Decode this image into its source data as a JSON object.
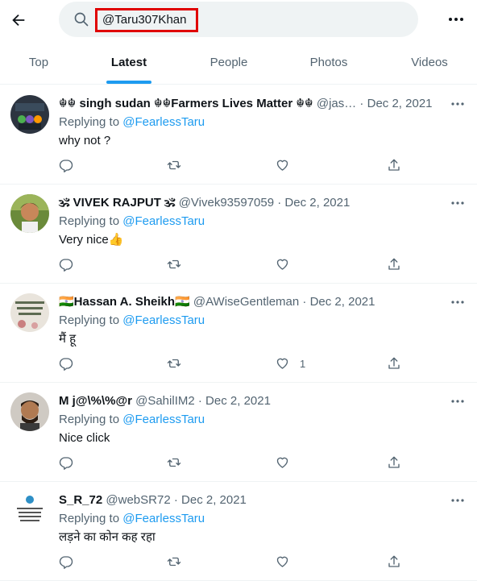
{
  "search": {
    "query": "@Taru307Khan"
  },
  "tabs": [
    {
      "label": "Top",
      "active": false
    },
    {
      "label": "Latest",
      "active": true
    },
    {
      "label": "People",
      "active": false
    },
    {
      "label": "Photos",
      "active": false
    },
    {
      "label": "Videos",
      "active": false
    }
  ],
  "tweets": [
    {
      "name": "☬☬ singh sudan ☬☬Farmers Lives Matter ☬☬",
      "handle": "@jas…",
      "date": "Dec 2, 2021",
      "replying_prefix": "Replying to",
      "replying_to": "@FearlessTaru",
      "text": "why not ?",
      "likes": ""
    },
    {
      "name": "🕉 VIVEK RAJPUT 🕉",
      "handle": "@Vivek93597059",
      "date": "Dec 2, 2021",
      "replying_prefix": "Replying to",
      "replying_to": "@FearlessTaru",
      "text": "Very nice👍",
      "likes": ""
    },
    {
      "name": "🇮🇳Hassan A. Sheikh🇮🇳",
      "handle": "@AWiseGentleman",
      "date": "Dec 2, 2021",
      "replying_prefix": "Replying to",
      "replying_to": "@FearlessTaru",
      "text": "मैं हू",
      "likes": "1"
    },
    {
      "name": "M j@\\%\\%@r",
      "handle": "@SahilIM2",
      "date": "Dec 2, 2021",
      "replying_prefix": "Replying to",
      "replying_to": "@FearlessTaru",
      "text": "Nice click",
      "likes": ""
    },
    {
      "name": "S_R_72",
      "handle": "@webSR72",
      "date": "Dec 2, 2021",
      "replying_prefix": "Replying to",
      "replying_to": "@FearlessTaru",
      "text": "लड़ने का कोन कह रहा",
      "likes": ""
    }
  ],
  "colors": {
    "accent": "#1d9bf0",
    "text": "#0f1419",
    "secondary": "#536471",
    "highlight_box": "#e00000"
  },
  "icons": [
    "back-arrow-icon",
    "search-icon",
    "more-icon",
    "reply-icon",
    "retweet-icon",
    "like-icon",
    "share-icon"
  ]
}
